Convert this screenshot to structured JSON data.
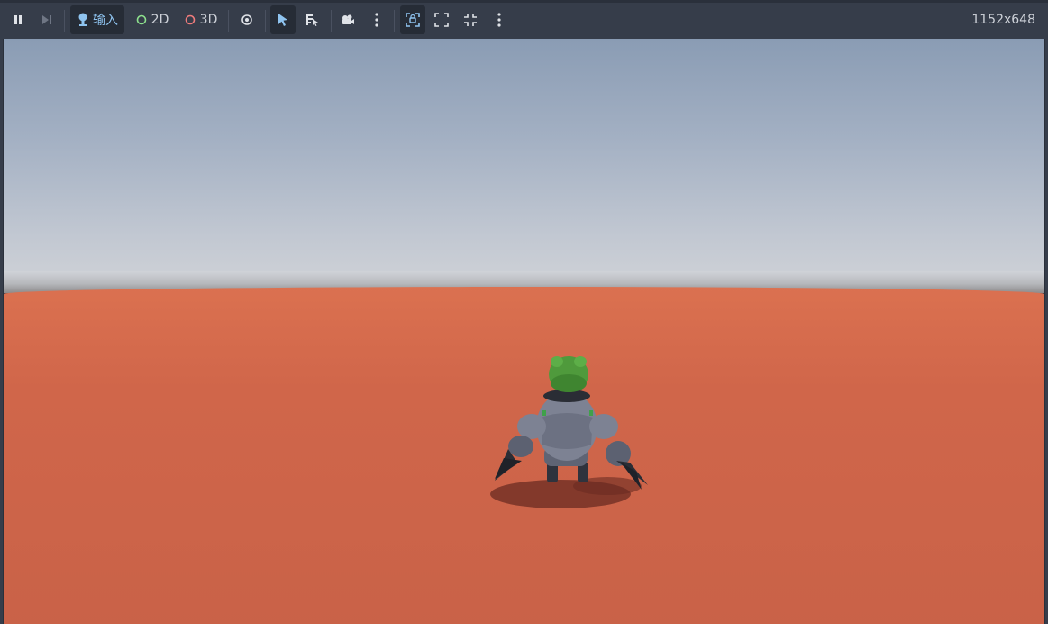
{
  "toolbar": {
    "pause_icon": "pause-icon",
    "step_icon": "step-frame-icon",
    "input_label": "输入",
    "input_icon": "input-joystick-icon",
    "mode_2d_label": "2D",
    "mode_3d_label": "3D",
    "visibility_icon": "eye-icon",
    "select_icon": "arrow-pointer-icon",
    "list_select_icon": "list-select-icon",
    "camera_icon": "camera-icon",
    "more_icon": "more-vertical-icon",
    "embed_icon": "embed-frame-icon",
    "fit_icon": "fit-frame-icon",
    "shrink_icon": "shrink-frame-icon",
    "resolution": "1152x648"
  },
  "colors": {
    "toolbar_bg": "#363d4a",
    "accent_blue": "#8fc4f0",
    "mode_2d": "#8de08d",
    "mode_3d": "#f07c7c",
    "ground": "#d0664a",
    "sky_top": "#8a9cb4",
    "character_head": "#4f9a3c",
    "character_body": "#7d8293"
  }
}
